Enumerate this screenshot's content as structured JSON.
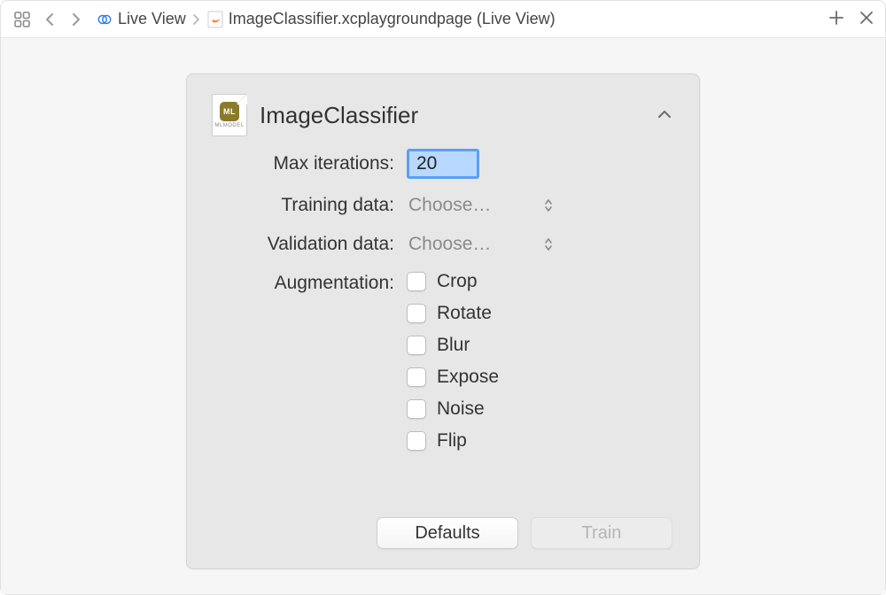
{
  "toolbar": {
    "breadcrumb": {
      "segment1": "Live View",
      "segment2": "ImageClassifier.xcplaygroundpage (Live View)"
    }
  },
  "panel": {
    "icon_caption": "MLMODEL",
    "icon_badge": "ML",
    "title": "ImageClassifier",
    "fields": {
      "max_iterations_label": "Max iterations:",
      "max_iterations_value": "20",
      "training_data_label": "Training data:",
      "training_data_button": "Choose…",
      "validation_data_label": "Validation data:",
      "validation_data_button": "Choose…",
      "augmentation_label": "Augmentation:"
    },
    "augmentation_options": [
      "Crop",
      "Rotate",
      "Blur",
      "Expose",
      "Noise",
      "Flip"
    ],
    "buttons": {
      "defaults": "Defaults",
      "train": "Train"
    }
  }
}
